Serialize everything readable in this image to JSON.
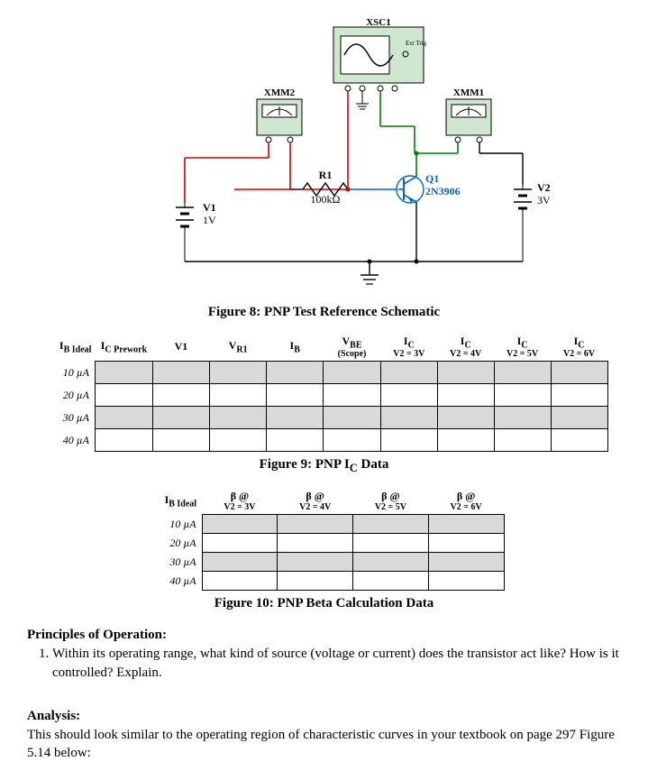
{
  "schematic": {
    "scope_label": "XSC1",
    "scope_trig": "Ext Trig",
    "meter_left": "XMM2",
    "meter_right": "XMM1",
    "r1_name": "R1",
    "r1_value": "100kΩ",
    "q1_name": "Q1",
    "q1_part": "2N3906",
    "v1_name": "V1",
    "v1_value": "1V",
    "v2_name": "V2",
    "v2_value": "3V"
  },
  "fig8_caption": "Figure 8: PNP Test Reference Schematic",
  "table9": {
    "headers": {
      "ib_ideal": "I",
      "ib_ideal_sub": "B Ideal",
      "ic_prework": "I",
      "ic_prework_sub": "C Prework",
      "v1": "V1",
      "vr1": "V",
      "vr1_sub": "R1",
      "ib": "I",
      "ib_sub": "B",
      "vbe": "V",
      "vbe_sub": "BE",
      "vbe_scope": "(Scope)",
      "ic3": "I",
      "ic_sub": "C",
      "ic3_line": "V2 = 3V",
      "ic4_line": "V2 = 4V",
      "ic5_line": "V2 = 5V",
      "ic6_line": "V2 = 6V"
    },
    "rows": [
      "10 µA",
      "20 µA",
      "30 µA",
      "40 µA"
    ]
  },
  "fig9_caption": "Figure 9: PNP I",
  "fig9_caption_sub": "C",
  "fig9_caption_tail": " Data",
  "table10": {
    "headers": {
      "ib_ideal": "I",
      "ib_ideal_sub": "B Ideal",
      "beta": "β @",
      "b3": "V2 = 3V",
      "b4": "V2 = 4V",
      "b5": "V2 = 5V",
      "b6": "V2 = 6V"
    },
    "rows": [
      "10 µA",
      "20 µA",
      "30 µA",
      "40 µA"
    ]
  },
  "fig10_caption": "Figure 10: PNP Beta Calculation Data",
  "principles_head": "Principles of Operation:",
  "principles_q1": "Within its operating range, what kind of source (voltage or current) does the transistor act like? How is it controlled? Explain.",
  "analysis_head": "Analysis:",
  "analysis_body": "This should look similar to the operating region of characteristic curves in your textbook on page 297 Figure 5.14 below:"
}
